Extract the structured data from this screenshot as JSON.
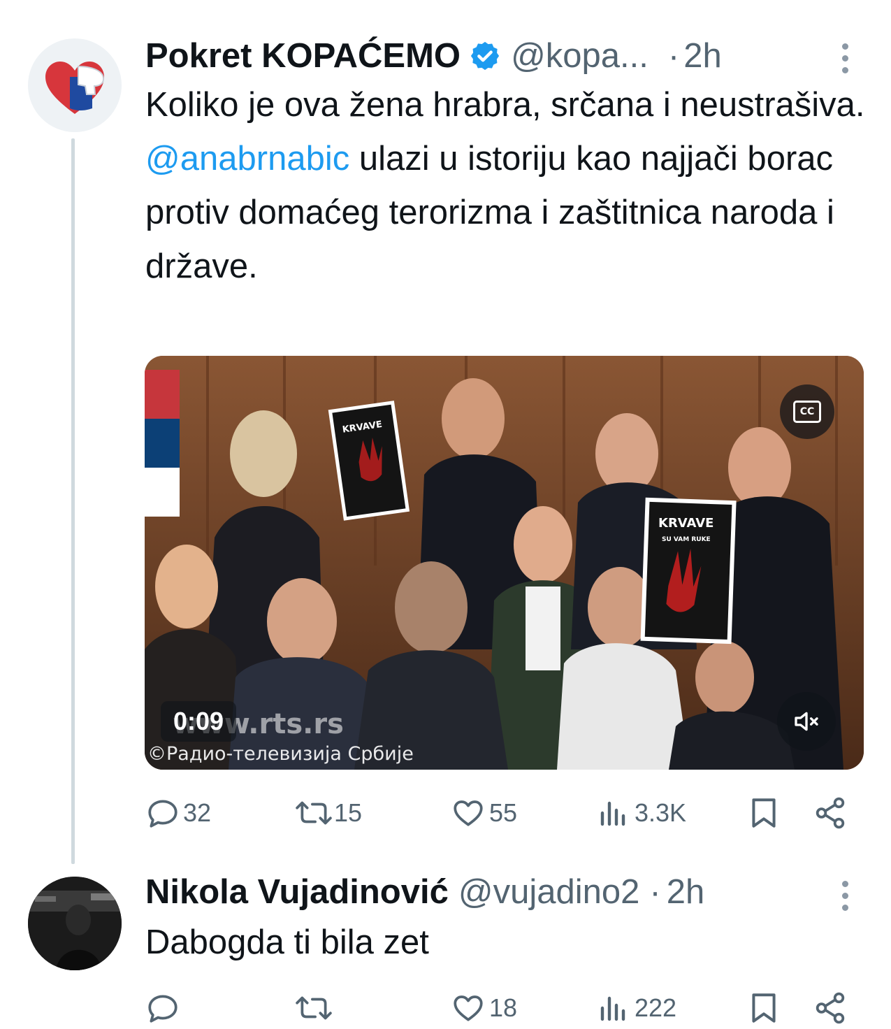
{
  "tweet1": {
    "author_name": "Pokret KOPAĆEMO",
    "handle": "@kopa...",
    "separator": "·",
    "time": "2h",
    "text_before_mention": "Koliko je ova žena hrabra, srčana i neustrašiva. ",
    "mention": "@anabrnabic",
    "text_after_mention": " ulazi u istoriju kao najjači borac protiv domaćeg terorizma i zaštitnica naroda i države.",
    "video": {
      "duration": "0:09",
      "cc_label": "CC",
      "watermark": "www.rts.rs",
      "copyright": "©Радио-телевизија Србије",
      "sign_text_top": "KRVAVE",
      "sign_text_bottom": "SU VAM RUKE"
    },
    "stats": {
      "replies": "32",
      "reposts": "15",
      "likes": "55",
      "views": "3.3K"
    }
  },
  "tweet2": {
    "author_name": "Nikola Vujadinović",
    "handle": "@vujadino2",
    "separator": "·",
    "time": "2h",
    "text": "Dabogda ti bila zet",
    "stats": {
      "likes": "18",
      "views": "222"
    }
  },
  "colors": {
    "text": "#0f1419",
    "secondary": "#536471",
    "accent": "#1d9bf0",
    "verified": "#1d9bf0",
    "thread_line": "#cfd9de"
  }
}
